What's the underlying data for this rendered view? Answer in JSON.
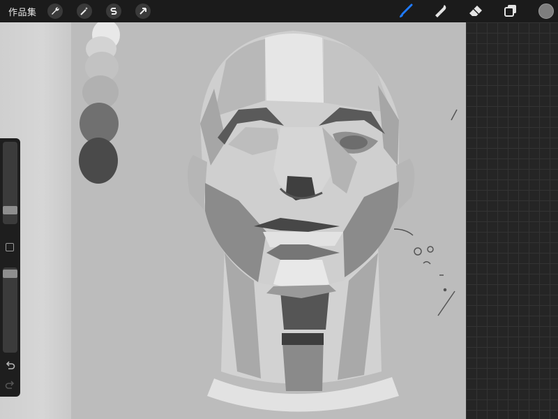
{
  "topbar": {
    "gallery_label": "作品集",
    "left_tools": [
      {
        "name": "actions",
        "icon": "wrench-icon"
      },
      {
        "name": "adjustments",
        "icon": "magic-wand-icon"
      },
      {
        "name": "selection",
        "icon": "selection-s-icon"
      },
      {
        "name": "transform",
        "icon": "arrow-cursor-icon"
      }
    ],
    "right_tools": [
      {
        "name": "brush",
        "icon": "brush-icon",
        "active": true
      },
      {
        "name": "smudge",
        "icon": "smudge-finger-icon",
        "active": false
      },
      {
        "name": "eraser",
        "icon": "eraser-icon",
        "active": false
      },
      {
        "name": "layers",
        "icon": "layers-icon",
        "active": false
      }
    ],
    "active_tool_color": "#1f7bff",
    "current_color": "#7e7e7e"
  },
  "sidebar": {
    "brush_size_level": 0.82,
    "opacity_level": 0.06,
    "buttons": [
      "modify-button",
      "undo-arrow-icon",
      "redo-arrow-icon"
    ]
  },
  "canvas": {
    "background_color": "#bcbcbc",
    "swatch_colors": [
      "#e6e6e6",
      "#d2d2d2",
      "#bdbdbd",
      "#a8a8a8",
      "#6e6e6e",
      "#4a4a4a"
    ]
  }
}
